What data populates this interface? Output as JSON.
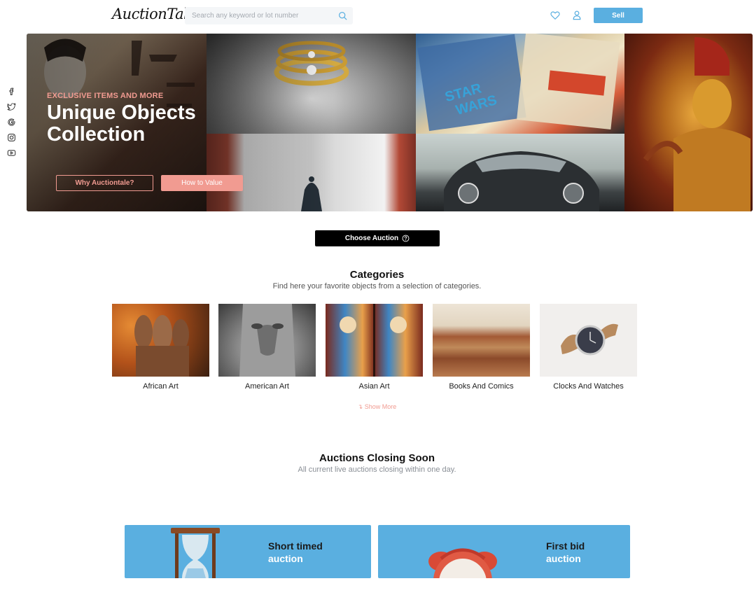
{
  "header": {
    "logo": "AuctionTale",
    "search_placeholder": "Search any keyword or lot number",
    "sell_label": "Sell",
    "icons": [
      "heart-icon",
      "user-icon",
      "search-icon"
    ]
  },
  "social": [
    "facebook-icon",
    "twitter-icon",
    "google-icon",
    "instagram-icon",
    "youtube-icon"
  ],
  "hero": {
    "eyebrow": "EXCLUSIVE ITEMS AND MORE",
    "title": "Unique Objects Collection",
    "why_label": "Why Auctiontale?",
    "value_label": "How to Value"
  },
  "choose_auction_label": "Choose Auction",
  "categories": {
    "title": "Categories",
    "subtitle": "Find here your favorite objects from a selection of categories.",
    "items": [
      {
        "label": "African Art"
      },
      {
        "label": "American Art"
      },
      {
        "label": "Asian Art"
      },
      {
        "label": "Books And Comics"
      },
      {
        "label": "Clocks And Watches"
      }
    ],
    "show_more": "Show More"
  },
  "closing": {
    "title": "Auctions Closing Soon",
    "subtitle": "All current live auctions closing within one day.",
    "cards": [
      {
        "line1": "Short timed",
        "line2": "auction"
      },
      {
        "line1": "First bid",
        "line2": "auction"
      }
    ]
  },
  "colors": {
    "accent_blue": "#5aafe0",
    "accent_pink": "#f19b91",
    "dark": "#000000"
  }
}
